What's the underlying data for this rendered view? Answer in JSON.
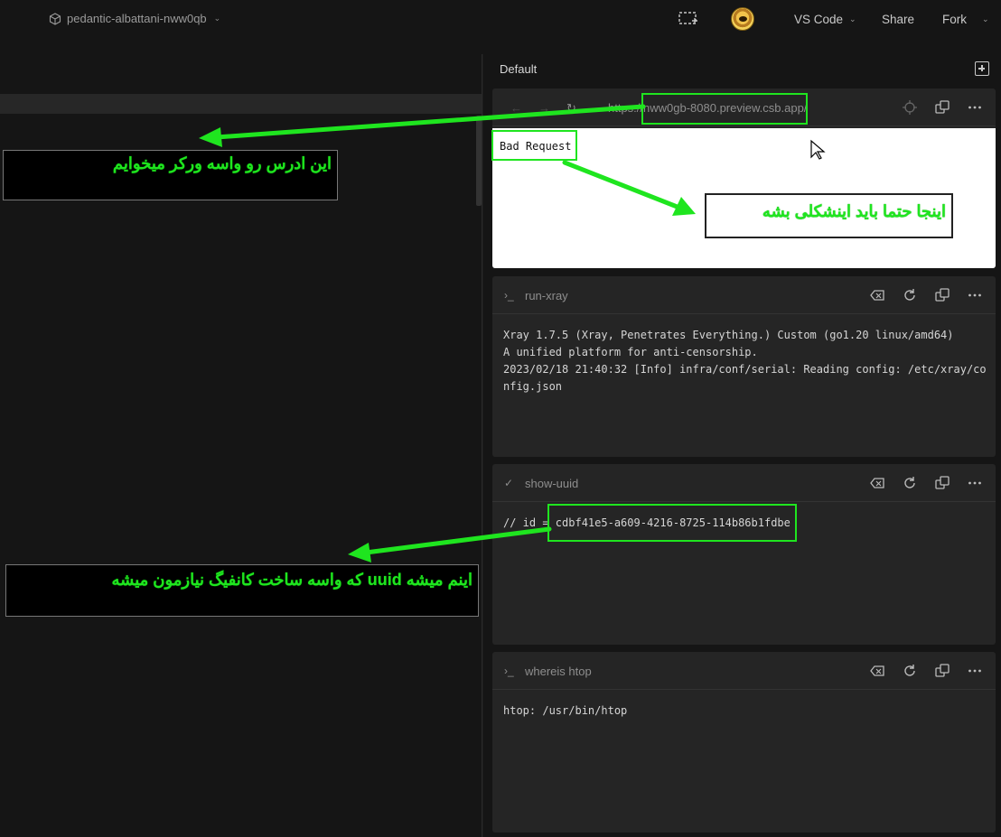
{
  "topbar": {
    "project_name": "pedantic-albattani-nww0qb",
    "editor_label": "VS Code",
    "share_label": "Share",
    "fork_label": "Fork"
  },
  "devtools": {
    "group_title": "Default",
    "browser": {
      "url": "https://nww0gb-8080.preview.csb.app/",
      "body_text": "Bad Request"
    },
    "panels": [
      {
        "title": "run-xray",
        "output": "Xray 1.7.5 (Xray, Penetrates Everything.) Custom (go1.20 linux/amd64)\nA unified platform for anti-censorship.\n2023/02/18 21:40:32 [Info] infra/conf/serial: Reading config: /etc/xray/config.json"
      },
      {
        "title": "show-uuid",
        "output_prefix": "// id = ",
        "output_value": "cdbf41e5-a609-4216-8725-114b86b1fdbe"
      },
      {
        "title": "whereis htop",
        "output": "htop: /usr/bin/htop"
      }
    ]
  },
  "annotations": {
    "note_address": "این ادرس رو واسه ورکر میخوایم",
    "note_bad_request": "اینجا حتما باید اینشکلی بشه",
    "note_uuid": "اینم میشه uuid که واسه ساخت کانفیگ نیازمون میشه"
  },
  "colors": {
    "annotation": "#1fe51f",
    "panel_bg": "#252525",
    "app_bg": "#151515"
  }
}
